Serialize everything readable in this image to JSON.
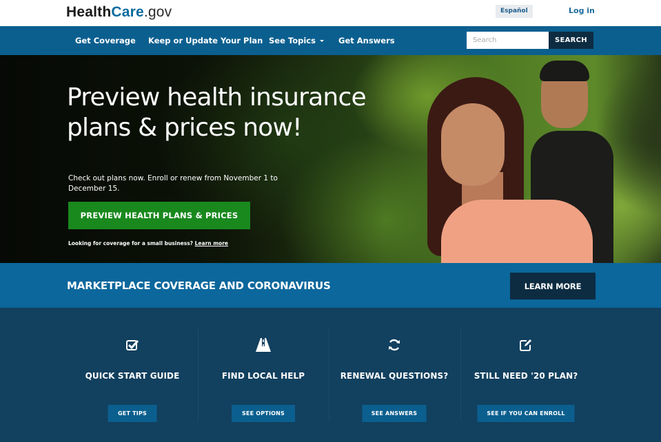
{
  "header": {
    "logo": {
      "part1": "Health",
      "part2": "Care",
      "part3": ".gov"
    },
    "espanol_label": "Español",
    "login_label": "Log in"
  },
  "nav": {
    "items": [
      {
        "label": "Get Coverage"
      },
      {
        "label": "Keep or Update Your Plan"
      },
      {
        "label": "See Topics",
        "has_dropdown": true
      },
      {
        "label": "Get Answers"
      }
    ],
    "search": {
      "placeholder": "Search",
      "value": "",
      "button_label": "SEARCH"
    }
  },
  "hero": {
    "title": "Preview health insurance plans & prices now!",
    "subtitle": "Check out plans now. Enroll or renew from November 1 to December 15.",
    "cta_label": "PREVIEW HEALTH PLANS & PRICES",
    "small_business_text": "Looking for coverage for a small business?",
    "small_business_link": "Learn more",
    "image_description": "woman in coral shirt and man in black t-shirt outdoors among green trees"
  },
  "banner": {
    "title": "MARKETPLACE COVERAGE AND CORONAVIRUS",
    "button_label": "LEARN MORE"
  },
  "features": [
    {
      "icon": "checkbox-icon",
      "title": "QUICK START GUIDE",
      "button_label": "GET TIPS"
    },
    {
      "icon": "road-icon",
      "title": "FIND LOCAL HELP",
      "button_label": "SEE OPTIONS"
    },
    {
      "icon": "refresh-icon",
      "title": "RENEWAL QUESTIONS?",
      "button_label": "SEE ANSWERS"
    },
    {
      "icon": "edit-icon",
      "title": "STILL NEED '20 PLAN?",
      "button_label": "SEE IF YOU CAN ENROLL"
    }
  ],
  "colors": {
    "nav_bg": "#0b5f8f",
    "banner_bg": "#0b679c",
    "features_bg": "#12405f",
    "cta_green": "#19891e",
    "dark_button": "#0d2c42",
    "logo_accent": "#0a6b9e"
  }
}
